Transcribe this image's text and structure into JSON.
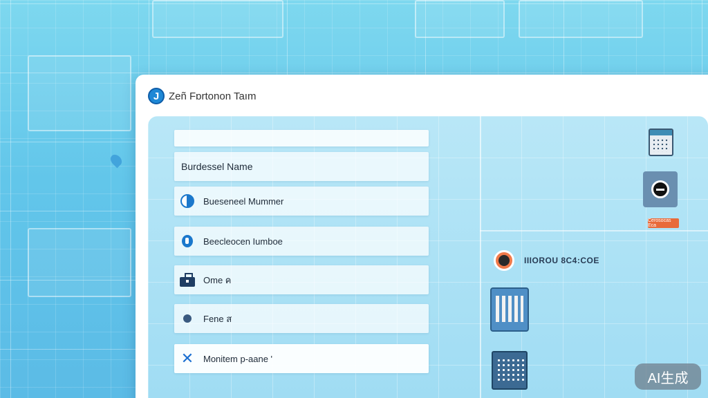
{
  "window": {
    "logo_letter": "J",
    "title": "Zeñ Fɒrtonon Taım"
  },
  "form": {
    "fields": [
      {
        "label": ""
      },
      {
        "label": "Burdessel Name"
      },
      {
        "label": "Bueseneel Mummer",
        "icon": "contact-icon"
      },
      {
        "label": "Beecleocen Iumboe",
        "icon": "location-icon"
      },
      {
        "label": "Ome ค",
        "icon": "briefcase-icon"
      },
      {
        "label": "Fene ส",
        "icon": "dot-icon"
      },
      {
        "label": "Monitem p-aane '",
        "icon": "close-icon"
      }
    ]
  },
  "side_panel": {
    "badge_text": "Cerosocas Eca",
    "avatar_label": "IIIOROU 8C4:COE"
  },
  "watermark": "AI生成",
  "colors": {
    "accent": "#1b78cc",
    "background": "#62c6ea",
    "badge": "#e86a3a"
  }
}
